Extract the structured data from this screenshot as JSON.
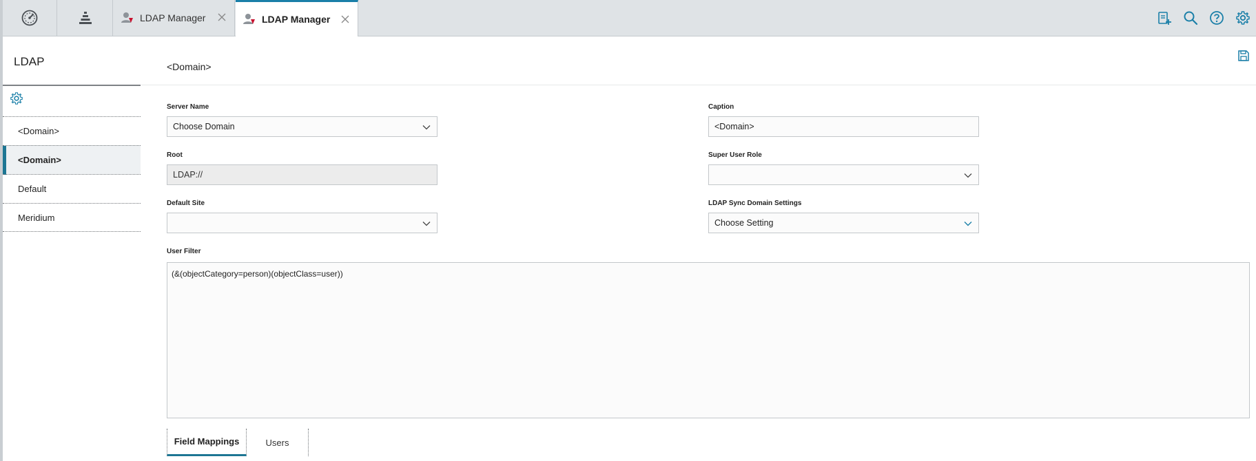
{
  "tabs": [
    {
      "label": "LDAP Manager",
      "active": false
    },
    {
      "label": "LDAP Manager",
      "active": true
    }
  ],
  "icons": {
    "dashboard": "dashboard-gauge-icon",
    "hierarchy": "pyramid-icon",
    "tab_icon": "user-manager-icon",
    "close": "close-icon",
    "new_record": "new-clipboard-icon",
    "search": "search-icon",
    "help": "help-icon",
    "settings": "gear-icon",
    "save": "save-disk-icon"
  },
  "colors": {
    "accent": "#1a7fa8",
    "selected_bar": "#1d7693",
    "tab_icon_red": "#c8102e"
  },
  "sidebar": {
    "title": "LDAP",
    "items": [
      {
        "label": "<Domain>",
        "selected": false
      },
      {
        "label": "<Domain>",
        "selected": true
      },
      {
        "label": "Default",
        "selected": false
      },
      {
        "label": "Meridium",
        "selected": false
      }
    ]
  },
  "main": {
    "title": "<Domain>",
    "fields": {
      "server_name": {
        "label": "Server Name",
        "value": "Choose Domain"
      },
      "caption": {
        "label": "Caption",
        "value": "<Domain>"
      },
      "root": {
        "label": "Root",
        "value": "LDAP://"
      },
      "super_user_role": {
        "label": "Super User Role",
        "value": ""
      },
      "default_site": {
        "label": "Default Site",
        "value": ""
      },
      "ldap_sync": {
        "label": "LDAP Sync Domain Settings",
        "value": "Choose Setting"
      },
      "user_filter": {
        "label": "User Filter",
        "value": "(&(objectCategory=person)(objectClass=user))"
      }
    },
    "bottom_tabs": [
      {
        "label": "Field Mappings",
        "active": true
      },
      {
        "label": "Users",
        "active": false
      }
    ]
  }
}
